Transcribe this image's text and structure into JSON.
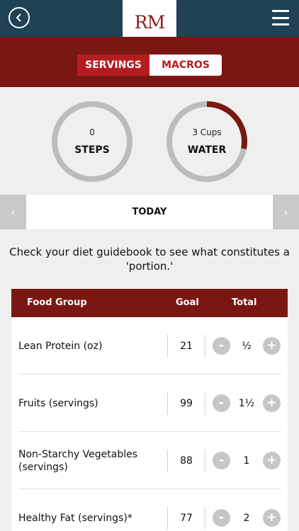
{
  "header": {
    "logo_text": "RM",
    "back_icon": "chevron-left-icon",
    "menu_icon": "hamburger-menu-icon",
    "bar_color": "#1f4254"
  },
  "tabs": [
    {
      "label": "SERVINGS",
      "active": true
    },
    {
      "label": "MACROS",
      "active": false
    }
  ],
  "trackers": [
    {
      "value": "0",
      "label": "STEPS",
      "progress": 0
    },
    {
      "value": "3 Cups",
      "label": "WATER",
      "progress": 0.28
    }
  ],
  "date_nav": {
    "label": "TODAY",
    "prev_icon": "chevron-left-icon",
    "next_icon": "chevron-right-icon"
  },
  "note": "Check your diet guidebook to see what constitutes a 'portion.'",
  "table": {
    "headers": {
      "food_group": "Food Group",
      "goal": "Goal",
      "total": "Total"
    },
    "rows": [
      {
        "name": "Lean Protein (oz)",
        "goal": "21",
        "total": "½"
      },
      {
        "name": "Fruits (servings)",
        "goal": "99",
        "total": "1½"
      },
      {
        "name": "Non-Starchy Vegetables (servings)",
        "goal": "88",
        "total": "1"
      },
      {
        "name": "Healthy Fat (servings)*",
        "goal": "77",
        "total": "2"
      }
    ],
    "minus_label": "-",
    "plus_label": "+"
  },
  "colors": {
    "brand_red": "#b51c22",
    "dark_red": "#7a1712",
    "ring_gray": "#bcbcbc"
  }
}
